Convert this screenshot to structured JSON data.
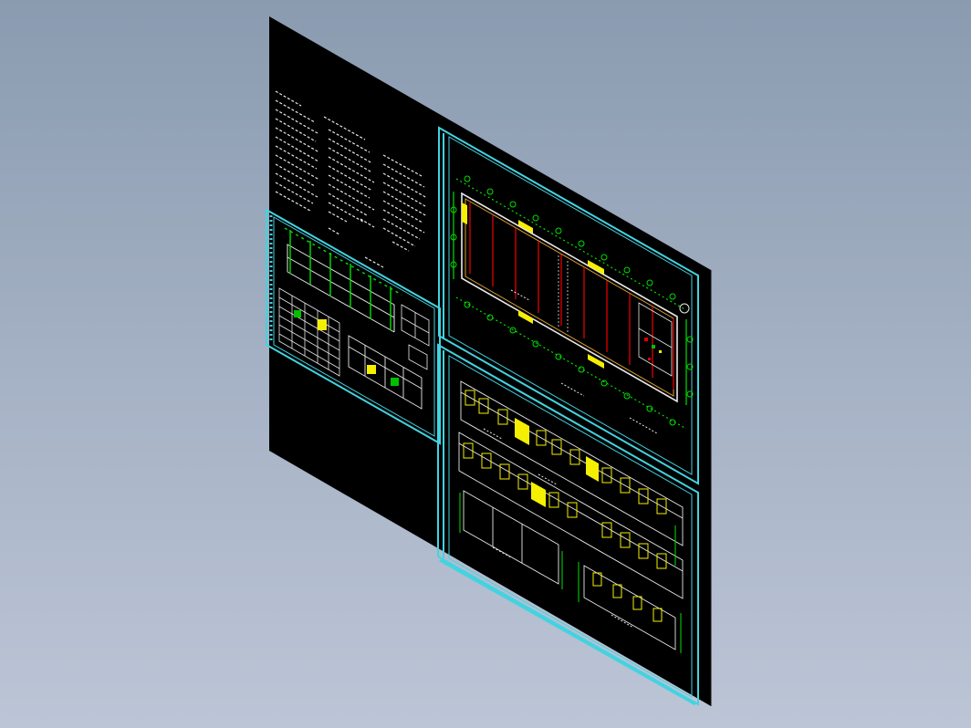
{
  "viewport": {
    "background_top": "#8a9bb0",
    "background_bottom": "#bcc5d6"
  },
  "model": {
    "view": "isometric",
    "sheets": [
      {
        "id": "general-notes-sheet",
        "content": "text-notes"
      },
      {
        "id": "details-sheet",
        "content": "sections-and-tables"
      },
      {
        "id": "floor-plan-sheet",
        "content": "floor-plan"
      },
      {
        "id": "elevations-sheet",
        "content": "elevations"
      }
    ],
    "colors": {
      "sheet": "#000000",
      "frame": "#43d3e0",
      "grid": "#00e000",
      "highlight": "#f5f000",
      "wall": "#e00000",
      "annotation": "#e8e8e8"
    }
  }
}
